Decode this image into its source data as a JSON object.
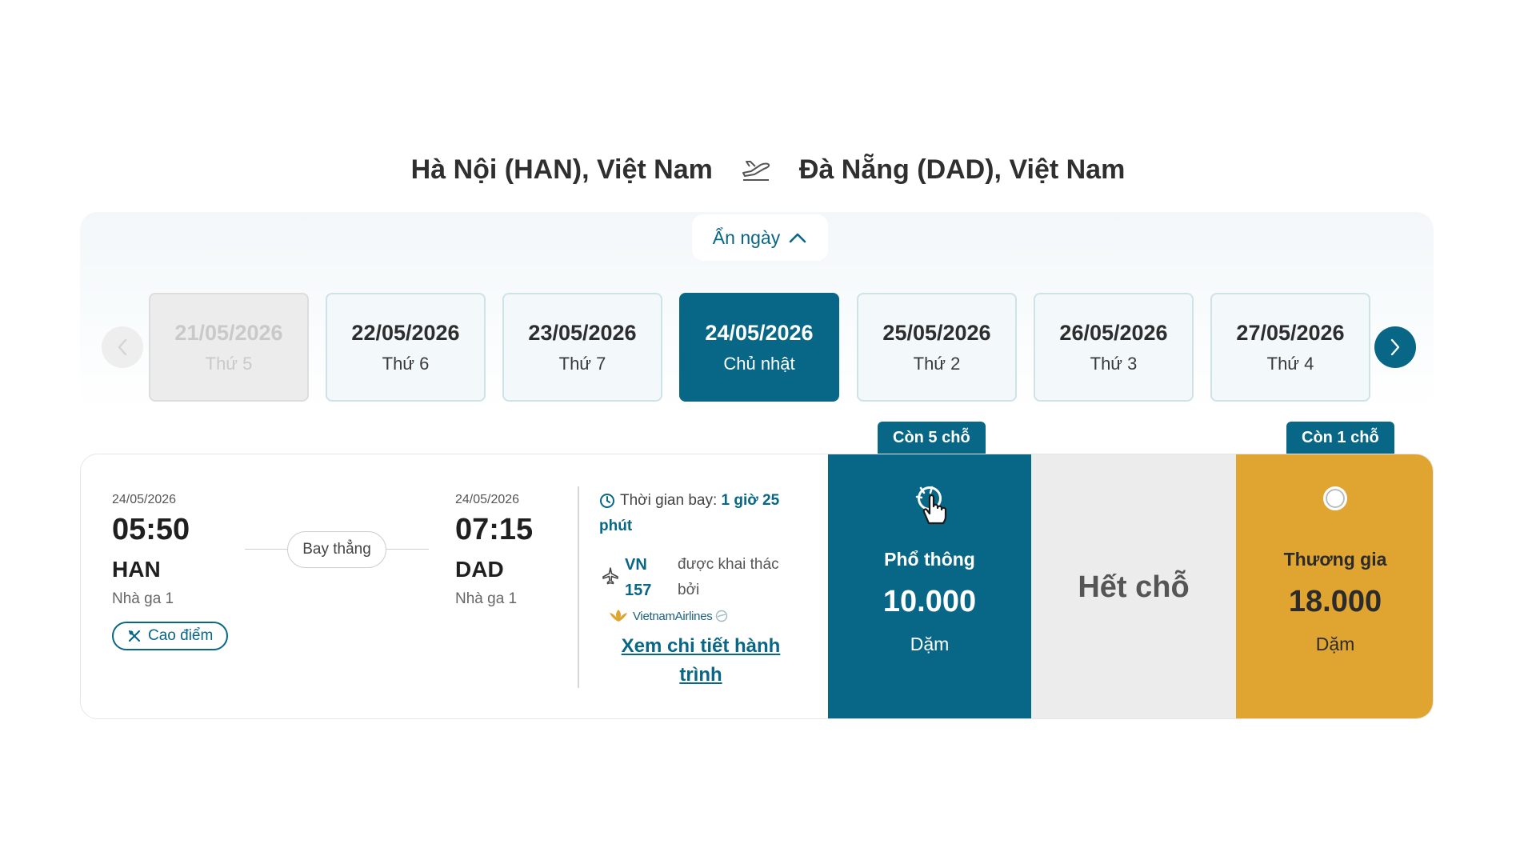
{
  "route": {
    "origin": "Hà Nội (HAN), Việt Nam",
    "destination": "Đà Nẵng (DAD), Việt Nam"
  },
  "date_selector": {
    "toggle_label": "Ẩn ngày",
    "days": [
      {
        "date": "21/05/2026",
        "weekday": "Thứ 5",
        "state": "disabled"
      },
      {
        "date": "22/05/2026",
        "weekday": "Thứ 6",
        "state": "normal"
      },
      {
        "date": "23/05/2026",
        "weekday": "Thứ 7",
        "state": "normal"
      },
      {
        "date": "24/05/2026",
        "weekday": "Chủ nhật",
        "state": "selected"
      },
      {
        "date": "25/05/2026",
        "weekday": "Thứ 2",
        "state": "normal"
      },
      {
        "date": "26/05/2026",
        "weekday": "Thứ 3",
        "state": "normal"
      },
      {
        "date": "27/05/2026",
        "weekday": "Thứ 4",
        "state": "normal"
      }
    ]
  },
  "badges": {
    "economy": "Còn 5 chỗ",
    "business": "Còn 1 chỗ"
  },
  "flight": {
    "depart": {
      "date": "24/05/2026",
      "time": "05:50",
      "code": "HAN",
      "terminal": "Nhà ga 1"
    },
    "arrive": {
      "date": "24/05/2026",
      "time": "07:15",
      "code": "DAD",
      "terminal": "Nhà ga 1"
    },
    "stop_label": "Bay thẳng",
    "peak_label": "Cao điểm",
    "duration_label": "Thời gian bay:",
    "duration_value": "1 giờ 25 phút",
    "flight_no_line1": "VN",
    "flight_no_line2": "157",
    "operated_line1": "được khai thác",
    "operated_line2": "bởi",
    "airline_logo_text": "VietnamAirlines",
    "detail_link": "Xem chi tiết hành trình"
  },
  "fares": {
    "economy": {
      "name": "Phổ thông",
      "price": "10.000",
      "unit": "Dặm"
    },
    "unavailable": {
      "label": "Hết chỗ"
    },
    "business": {
      "name": "Thương gia",
      "price": "18.000",
      "unit": "Dặm"
    }
  },
  "colors": {
    "primary": "#086687",
    "business": "#e0a431",
    "unavailable": "#ececec"
  }
}
